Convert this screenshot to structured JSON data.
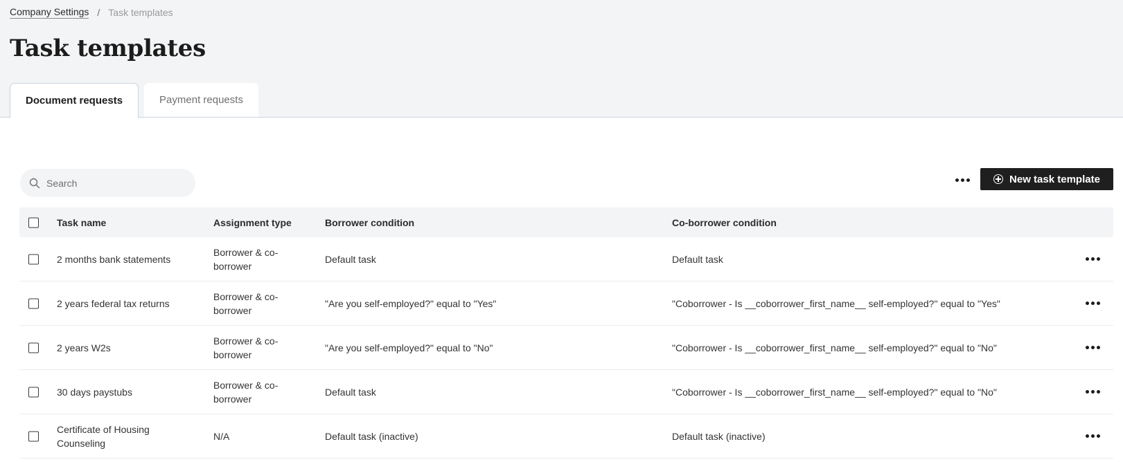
{
  "breadcrumb": {
    "parent": "Company Settings",
    "separator": "/",
    "current": "Task templates"
  },
  "page": {
    "title": "Task templates"
  },
  "tabs": [
    {
      "label": "Document requests",
      "active": true
    },
    {
      "label": "Payment requests",
      "active": false
    }
  ],
  "search": {
    "placeholder": "Search",
    "value": ""
  },
  "toolbar": {
    "new_button_label": "New task template",
    "more_icon": "ellipsis-horizontal-icon"
  },
  "table": {
    "columns": [
      "Task name",
      "Assignment type",
      "Borrower condition",
      "Co-borrower condition"
    ],
    "rows": [
      {
        "task_name": "2 months bank statements",
        "assignment_type": "Borrower & co-borrower",
        "borrower_condition": "Default task",
        "coborrower_condition": "Default task"
      },
      {
        "task_name": "2 years federal tax returns",
        "assignment_type": "Borrower & co-borrower",
        "borrower_condition": "\"Are you self-employed?\" equal to \"Yes\"",
        "coborrower_condition": "\"Coborrower - Is __coborrower_first_name__ self-employed?\" equal to \"Yes\""
      },
      {
        "task_name": "2 years W2s",
        "assignment_type": "Borrower & co-borrower",
        "borrower_condition": "\"Are you self-employed?\" equal to \"No\"",
        "coborrower_condition": "\"Coborrower - Is __coborrower_first_name__ self-employed?\" equal to \"No\""
      },
      {
        "task_name": "30 days paystubs",
        "assignment_type": "Borrower & co-borrower",
        "borrower_condition": "Default task",
        "coborrower_condition": "\"Coborrower - Is __coborrower_first_name__ self-employed?\" equal to \"No\""
      },
      {
        "task_name": "Certificate of Housing Counseling",
        "assignment_type": "N/A",
        "borrower_condition": "Default task (inactive)",
        "coborrower_condition": "Default task (inactive)"
      }
    ]
  },
  "colors": {
    "header_background": "#f3f4f6",
    "primary_button": "#1f1f1f",
    "divider": "#c9d3df"
  }
}
